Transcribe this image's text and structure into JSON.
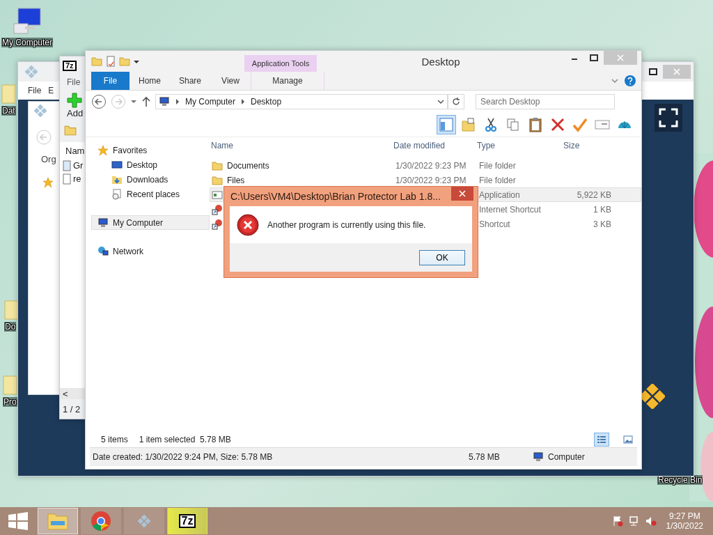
{
  "desktop_icons": [
    {
      "label": "My Computer",
      "kind": "computer"
    },
    {
      "label": "Dat",
      "kind": "partial"
    },
    {
      "label": "Do",
      "kind": "partial"
    },
    {
      "label": "Pro",
      "kind": "partial"
    },
    {
      "label": "Recycle Bin",
      "kind": "recycle"
    }
  ],
  "emulator_window": {
    "menu": [
      "File",
      "E"
    ]
  },
  "side_window": {
    "toolbar_label": "Org"
  },
  "archiver_window": {
    "logo": "7z",
    "menu": [
      "File"
    ],
    "toolbar": [
      "Add"
    ],
    "column": "Nam",
    "rows": [
      {
        "name": "Gr",
        "kind": "doc"
      },
      {
        "name": "re",
        "kind": "text"
      }
    ],
    "scroll_arrow": "<",
    "status": "1 / 2"
  },
  "explorer": {
    "title": "Desktop",
    "context_group": "Application Tools",
    "tabs": [
      {
        "label": "File",
        "kind": "file",
        "selected": false
      },
      {
        "label": "Home",
        "kind": "plain",
        "selected": false
      },
      {
        "label": "Share",
        "kind": "plain",
        "selected": false
      },
      {
        "label": "View",
        "kind": "plain",
        "selected": false
      },
      {
        "label": "Manage",
        "kind": "context",
        "selected": false
      }
    ],
    "breadcrumbs": [
      "My Computer",
      "Desktop"
    ],
    "search": {
      "placeholder": "Search Desktop"
    },
    "toolbar": [
      {
        "kind": "pane",
        "on": true
      },
      {
        "kind": "folder",
        "on": false
      },
      {
        "kind": "cut",
        "on": false
      },
      {
        "kind": "copy",
        "on": false
      },
      {
        "kind": "paste",
        "on": false
      },
      {
        "kind": "delete",
        "on": false
      },
      {
        "kind": "check",
        "on": false
      },
      {
        "kind": "card",
        "on": false
      },
      {
        "kind": "shell",
        "on": false
      }
    ],
    "nav": [
      {
        "label": "Favorites",
        "kind": "star",
        "selected": false,
        "children": [
          {
            "label": "Desktop",
            "kind": "desktop",
            "selected": false
          },
          {
            "label": "Downloads",
            "kind": "downloads",
            "selected": false
          },
          {
            "label": "Recent places",
            "kind": "recent",
            "selected": false
          }
        ]
      },
      {
        "label": "My Computer",
        "kind": "computer",
        "selected": true
      },
      {
        "label": "Network",
        "kind": "network",
        "selected": false
      }
    ],
    "columns": [
      "Name",
      "Date modified",
      "Type",
      "Size"
    ],
    "rows": [
      {
        "kind": "folder",
        "name": "Documents",
        "date": "1/30/2022 9:23 PM",
        "type": "File folder",
        "selected": false
      },
      {
        "kind": "folder",
        "name": "Files",
        "date": "1/30/2022 9:23 PM",
        "type": "File folder",
        "selected": false
      },
      {
        "kind": "app",
        "type": "Application",
        "size": "5,922 KB",
        "selected": true
      },
      {
        "kind": "shortcut",
        "type": "Internet Shortcut",
        "size": "1 KB",
        "selected": false
      },
      {
        "kind": "shortcut",
        "type": "Shortcut",
        "size": "3 KB",
        "selected": false
      }
    ],
    "status": {
      "count": "5 items",
      "selection": "1 item selected  5.78 MB"
    },
    "views": [
      {
        "kind": "details",
        "selected": true
      },
      {
        "kind": "tiles",
        "selected": false
      }
    ],
    "details_bar": {
      "info": "Date created: 1/30/2022 9:24 PM, Size: 5.78 MB",
      "size": "5.78 MB",
      "location": "Computer"
    }
  },
  "dialog": {
    "title": "C:\\Users\\VM4\\Desktop\\Brian Protector Lab 1.8...",
    "message": "Another program is currently using this file.",
    "button": "OK"
  },
  "taskbar": {
    "items": [
      {
        "kind": "explorer",
        "selected": true
      },
      {
        "kind": "chrome",
        "selected": false
      },
      {
        "kind": "emulator",
        "selected": false
      },
      {
        "kind": "archiver",
        "label": "7z",
        "selected": false
      }
    ],
    "time": "9:27 PM",
    "date": "1/30/2022"
  }
}
